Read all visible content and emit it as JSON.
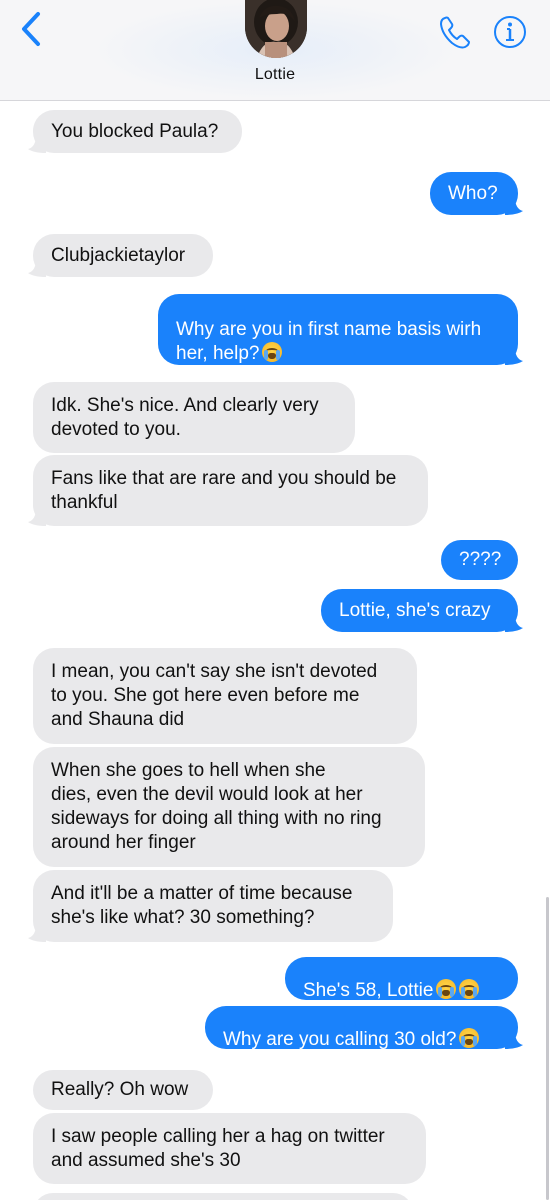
{
  "contact": {
    "name": "Lottie"
  },
  "colors": {
    "sent": "#1a82fb",
    "received": "#e9e9eb",
    "accent": "#1a82fb"
  },
  "messages": [
    {
      "from": "them",
      "text": "You blocked Paula?"
    },
    {
      "from": "me",
      "text": "Who?"
    },
    {
      "from": "them",
      "text": "Clubjackietaylor"
    },
    {
      "from": "me",
      "text": "Why are you in first name basis wirh\nher, help?",
      "emoji_count": 1
    },
    {
      "from": "them",
      "text": "Idk. She's nice. And clearly very\ndevoted to you."
    },
    {
      "from": "them",
      "text": "Fans like that are rare and you should be\nthankful"
    },
    {
      "from": "me",
      "text": "????"
    },
    {
      "from": "me",
      "text": "Lottie, she's crazy"
    },
    {
      "from": "them",
      "text": "I mean, you can't say she isn't devoted\nto you. She got here even before me\nand Shauna did"
    },
    {
      "from": "them",
      "text": "When she goes to hell when she\ndies, even the devil would look at her\nsideways for doing all thing with no ring\naround her finger"
    },
    {
      "from": "them",
      "text": "And it'll be a matter of time because\nshe's like what? 30 something?"
    },
    {
      "from": "me",
      "text": "She's 58, Lottie",
      "emoji_count": 2
    },
    {
      "from": "me",
      "text": "Why are you calling 30 old?",
      "emoji_count": 1
    },
    {
      "from": "them",
      "text": "Really? Oh wow"
    },
    {
      "from": "them",
      "text": "I saw people calling her a hag on twitter\nand assumed she's 30"
    }
  ]
}
